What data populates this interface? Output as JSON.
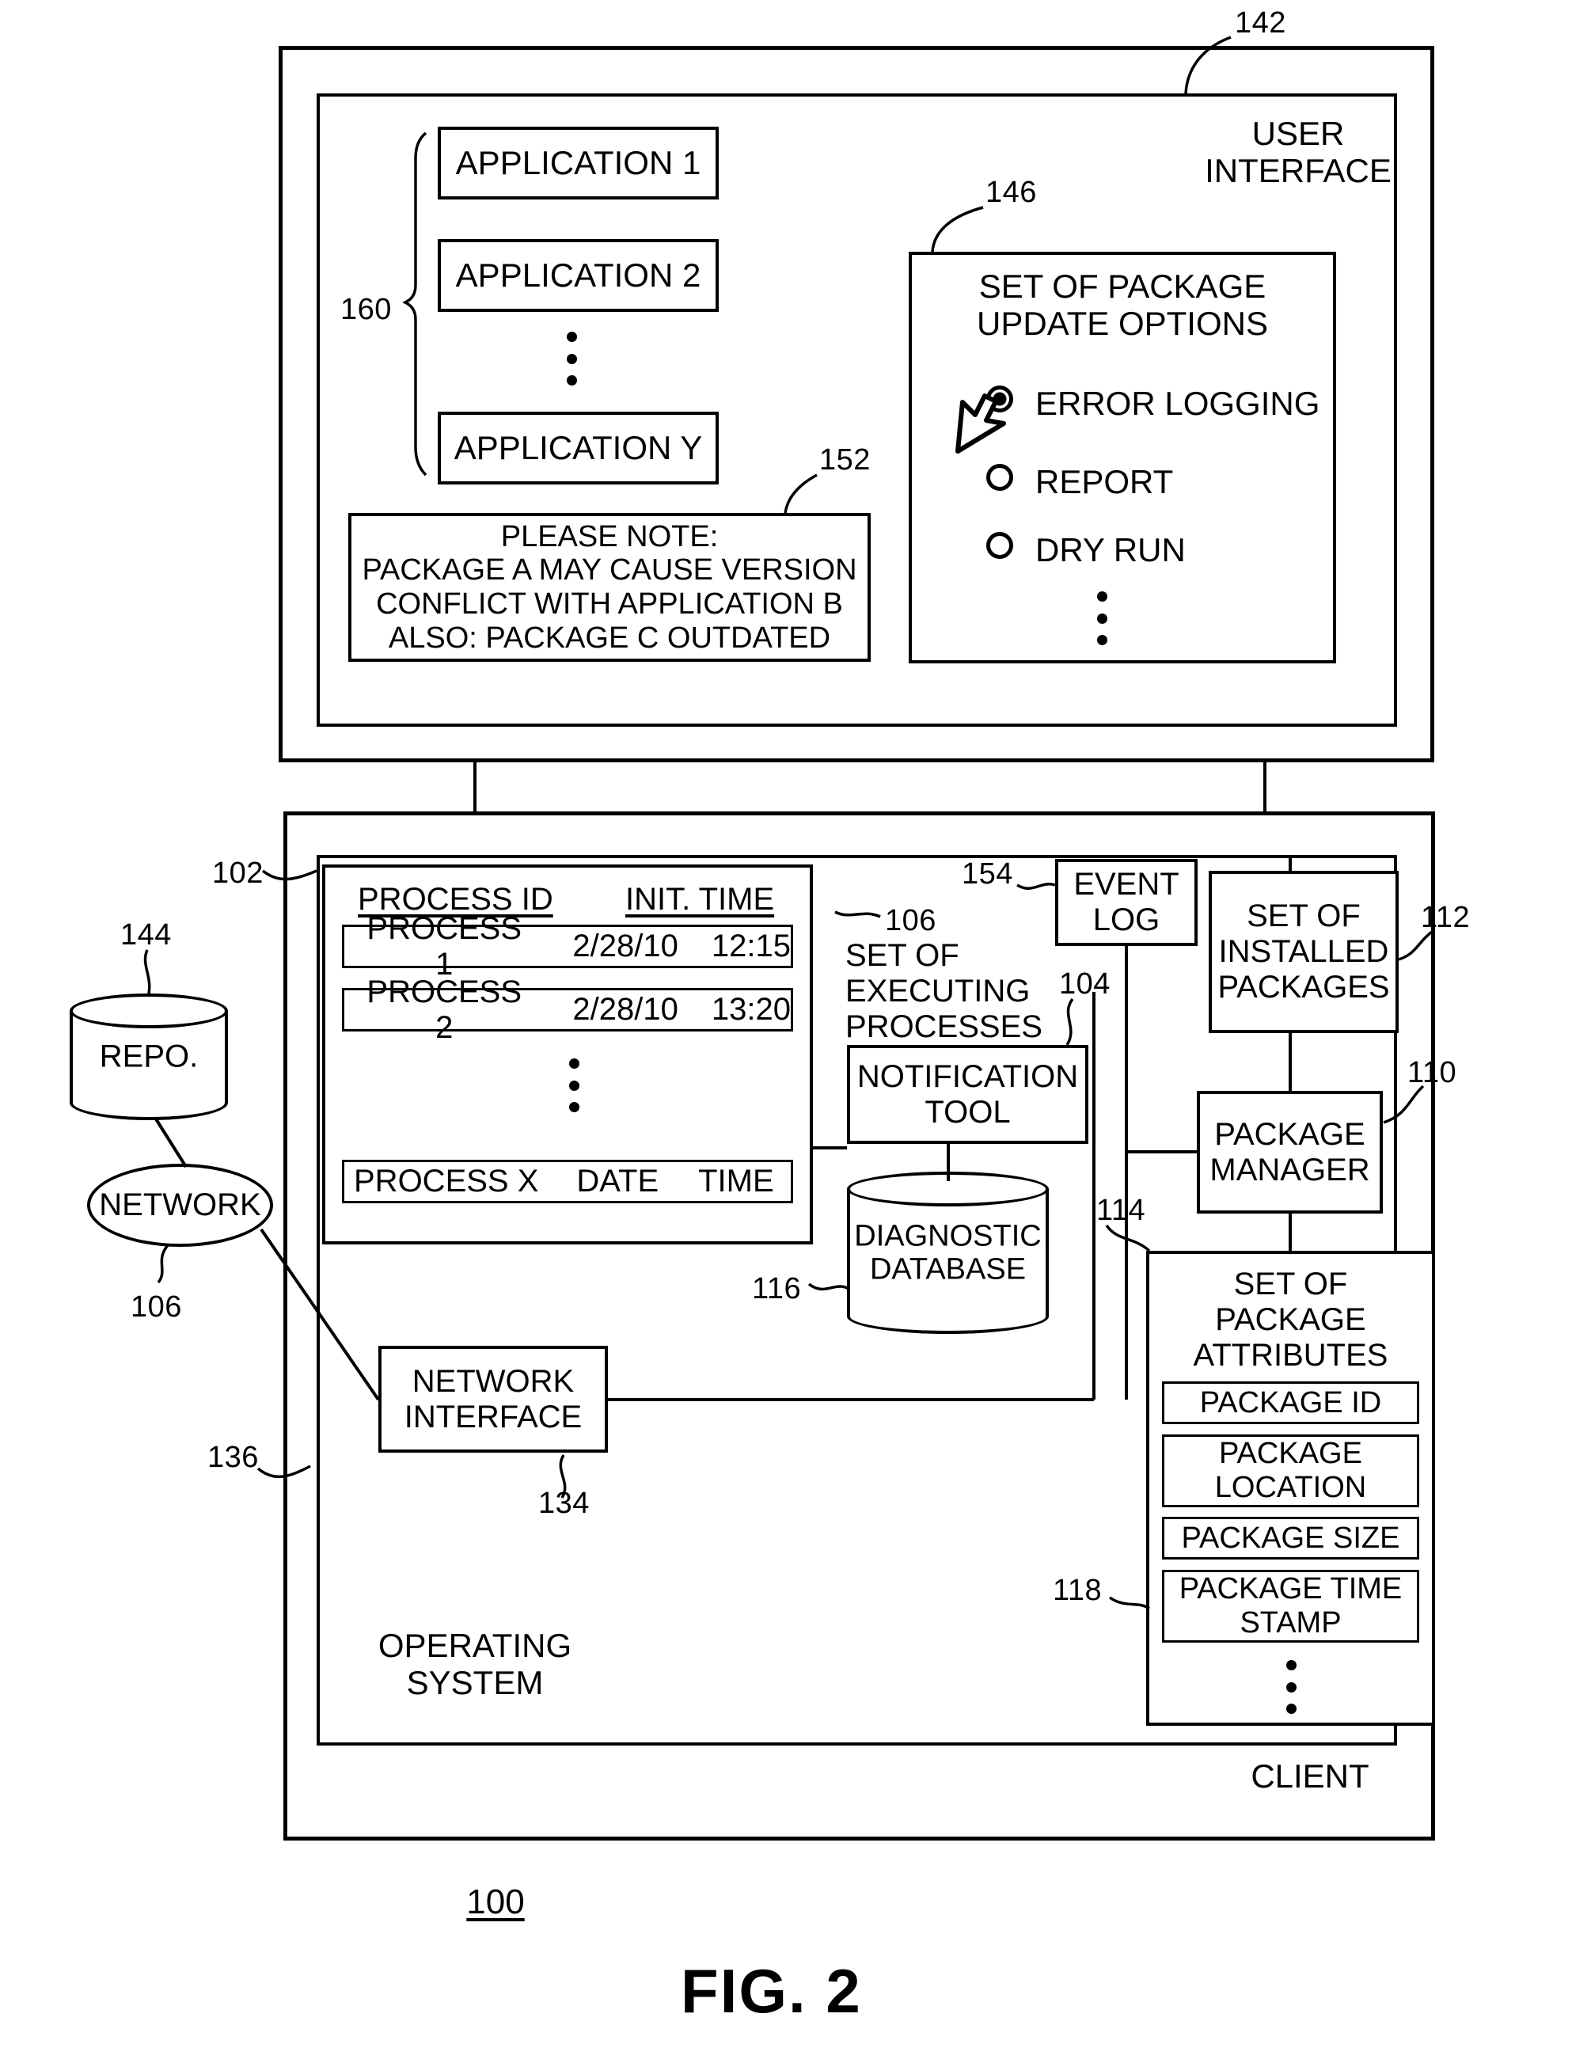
{
  "figure": {
    "caption": "FIG. 2",
    "system_ref": "100"
  },
  "ui_panel": {
    "ref": "142",
    "title": "USER\nINTERFACE",
    "applications": {
      "ref": "160",
      "items": [
        {
          "label": "APPLICATION 1"
        },
        {
          "label": "APPLICATION 2"
        },
        {
          "label": "APPLICATION Y"
        }
      ],
      "ellipsis": "⋮"
    },
    "note": {
      "ref": "152",
      "lines": [
        "PLEASE NOTE:",
        "PACKAGE A MAY CAUSE VERSION",
        "CONFLICT WITH APPLICATION B",
        "ALSO: PACKAGE C OUTDATED"
      ]
    },
    "update_options": {
      "ref": "146",
      "title": "SET OF PACKAGE\nUPDATE OPTIONS",
      "options": [
        {
          "label": "ERROR LOGGING",
          "selected": true
        },
        {
          "label": "REPORT",
          "selected": false
        },
        {
          "label": "DRY RUN",
          "selected": false
        }
      ],
      "ellipsis": "⋮",
      "cursor_icon": "mouse-pointer-icon"
    }
  },
  "client": {
    "ref": "136",
    "label": "CLIENT",
    "operating_system": {
      "ref": "102",
      "label": "OPERATING\nSYSTEM"
    },
    "process_table": {
      "ref": "106",
      "ref_label": "SET OF\nEXECUTING\nPROCESSES",
      "headers": [
        "PROCESS ID",
        "INIT. TIME"
      ],
      "rows": [
        {
          "id": "PROCESS 1",
          "date": "2/28/10",
          "time": "12:15"
        },
        {
          "id": "PROCESS 2",
          "date": "2/28/10",
          "time": "13:20"
        },
        {
          "id": "PROCESS X",
          "date": "DATE",
          "time": "TIME"
        }
      ],
      "ellipsis": "⋮"
    },
    "notification_tool": {
      "ref": "104",
      "label": "NOTIFICATION\nTOOL"
    },
    "event_log": {
      "ref": "154",
      "label": "EVENT\nLOG"
    },
    "installed_packages": {
      "ref": "112",
      "label": "SET OF\nINSTALLED\nPACKAGES"
    },
    "package_manager": {
      "ref": "110",
      "label": "PACKAGE\nMANAGER"
    },
    "diagnostic_database": {
      "ref": "116",
      "label": "DIAGNOSTIC\nDATABASE"
    },
    "package_attributes": {
      "ref": "114",
      "title": "SET OF\nPACKAGE\nATTRIBUTES",
      "attribute_ref": "118",
      "items": [
        {
          "label": "PACKAGE ID"
        },
        {
          "label": "PACKAGE\nLOCATION"
        },
        {
          "label": "PACKAGE SIZE"
        },
        {
          "label": "PACKAGE TIME\nSTAMP"
        }
      ],
      "ellipsis": "⋮"
    },
    "network_interface": {
      "ref": "134",
      "label": "NETWORK\nINTERFACE"
    }
  },
  "external": {
    "repository": {
      "ref": "144",
      "label": "REPO."
    },
    "network": {
      "ref": "106",
      "label": "NETWORK"
    }
  }
}
